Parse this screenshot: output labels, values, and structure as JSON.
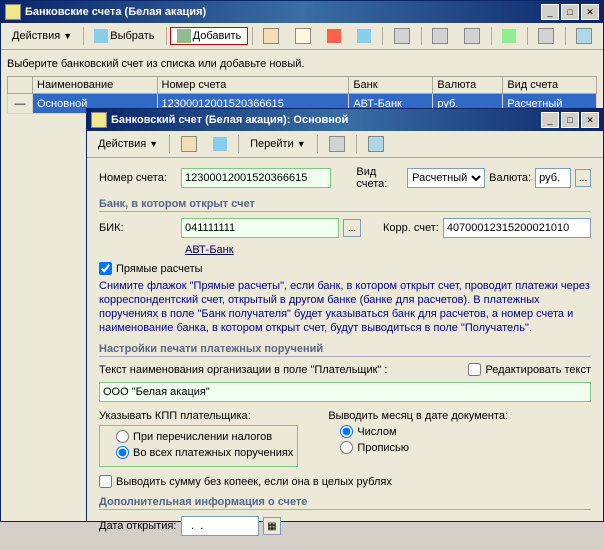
{
  "main_window": {
    "title": "Банковские счета (Белая акация)",
    "btn_min": "_",
    "btn_max": "□",
    "btn_close": "✕",
    "toolbar": {
      "actions": "Действия",
      "select": "Выбрать",
      "add": "Добавить"
    },
    "hint": "Выберите банковский счет из списка или добавьте новый.",
    "headers": {
      "name": "Наименование",
      "number": "Номер счета",
      "bank": "Банк",
      "currency": "Валюта",
      "type": "Вид счета"
    },
    "row": {
      "mark": "—",
      "name": "Основной",
      "number": "12300012001520366615",
      "bank": "АВТ-Банк",
      "currency": "руб.",
      "type": "Расчетный"
    }
  },
  "child_window": {
    "title": "Банковский счет (Белая акация): Основной",
    "toolbar": {
      "actions": "Действия",
      "goto": "Перейти"
    },
    "labels": {
      "acct_no": "Номер счета:",
      "acct_type": "Вид счета:",
      "currency": "Валюта:",
      "bik": "БИК:",
      "corr": "Корр. счет:",
      "direct": "Прямые расчеты",
      "payer_text": "Текст наименования организации в поле \"Плательщик\" :",
      "edit_text": "Редактировать текст",
      "kpp": "Указывать КПП плательщика:",
      "month": "Выводить месяц в дате документа:",
      "r_tax": "При перечислении налогов",
      "r_all": "Во всех платежных поручениях",
      "r_num": "Числом",
      "r_word": "Прописью",
      "no_kop": "Выводить сумму без копеек, если она в целых рублях",
      "open_date": "Дата открытия:"
    },
    "sections": {
      "bank": "Банк, в котором открыт счет",
      "print": "Настройки печати платежных поручений",
      "extra": "Дополнительная информация о счете"
    },
    "values": {
      "acct_no": "12300012001520366615",
      "acct_type": "Расчетный",
      "currency": "руб.",
      "bik": "041111111",
      "corr": "40700012315200021010",
      "bank_link": "АВТ-Банк",
      "payer": "ООО \"Белая акация\"",
      "open_date": "  .  .    "
    },
    "help": "Снимите флажок \"Прямые расчеты\", если банк, в котором открыт счет, проводит платежи через корреспондентский счет, открытый в другом банке (банке для расчетов). В платежных поручениях в поле \"Банк получателя\" будет указываться банк для расчетов, а номер счета и наименование банка, в котором открыт счет, будут выводиться в поле \"Получатель\"."
  }
}
